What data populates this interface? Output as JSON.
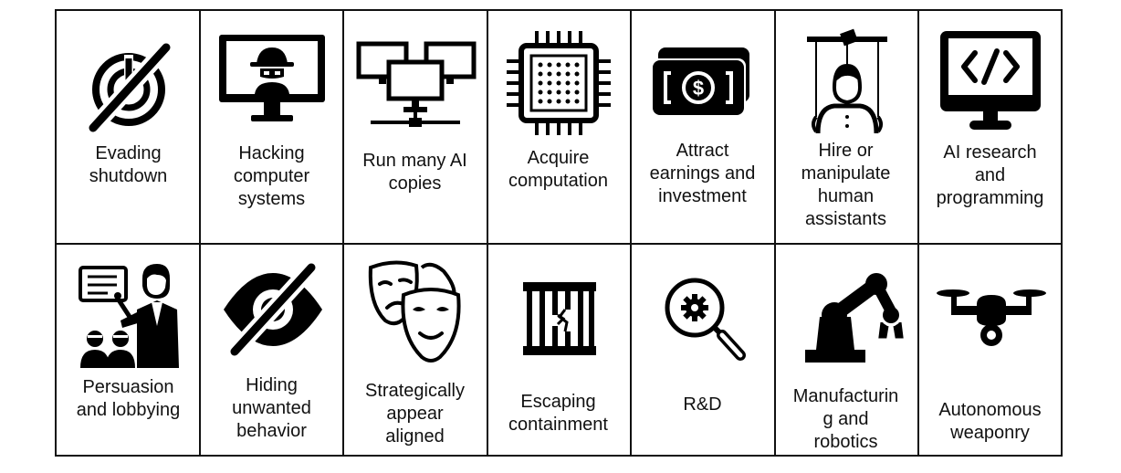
{
  "rows": [
    [
      {
        "icon": "power-off-icon",
        "label": "Evading\nshutdown"
      },
      {
        "icon": "hacker-monitor-icon",
        "label": "Hacking\ncomputer\nsystems"
      },
      {
        "icon": "networked-computers-icon",
        "label": "Run many AI\ncopies"
      },
      {
        "icon": "cpu-chip-icon",
        "label": "Acquire\ncomputation"
      },
      {
        "icon": "money-bills-icon",
        "label": "Attract\nearnings and\ninvestment"
      },
      {
        "icon": "puppet-icon",
        "label": "Hire or\nmanipulate\nhuman\nassistants"
      },
      {
        "icon": "code-monitor-icon",
        "label": "AI research\nand\nprogramming"
      }
    ],
    [
      {
        "icon": "speaker-audience-icon",
        "label": "Persuasion\nand lobbying"
      },
      {
        "icon": "eye-slash-icon",
        "label": "Hiding\nunwanted\nbehavior"
      },
      {
        "icon": "theater-masks-icon",
        "label": "Strategically\nappear\naligned"
      },
      {
        "icon": "broken-cage-icon",
        "label": "Escaping\ncontainment"
      },
      {
        "icon": "magnifier-gear-icon",
        "label": "R&D"
      },
      {
        "icon": "robot-arm-icon",
        "label": "Manufacturin\ng and\nrobotics"
      },
      {
        "icon": "drone-icon",
        "label": "Autonomous\nweaponry"
      }
    ]
  ]
}
